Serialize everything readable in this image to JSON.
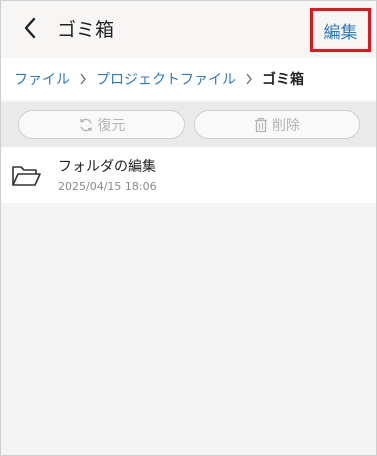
{
  "header": {
    "title": "ゴミ箱",
    "edit_label": "編集"
  },
  "breadcrumb": [
    {
      "label": "ファイル"
    },
    {
      "label": "プロジェクトファイル"
    },
    {
      "label": "ゴミ箱"
    }
  ],
  "toolbar": {
    "restore_label": "復元",
    "delete_label": "削除"
  },
  "items": [
    {
      "name": "フォルダの編集",
      "date": "2025/04/15 18:06"
    }
  ],
  "colors": {
    "accent": "#2c7bc2",
    "highlight_border": "#e8141b",
    "disabled_text": "#b4b4b4"
  },
  "icons": {
    "back": "chevron-left-icon",
    "separator": "chevron-right-icon",
    "restore": "refresh-icon",
    "delete": "trash-icon",
    "item": "folder-open-icon"
  }
}
